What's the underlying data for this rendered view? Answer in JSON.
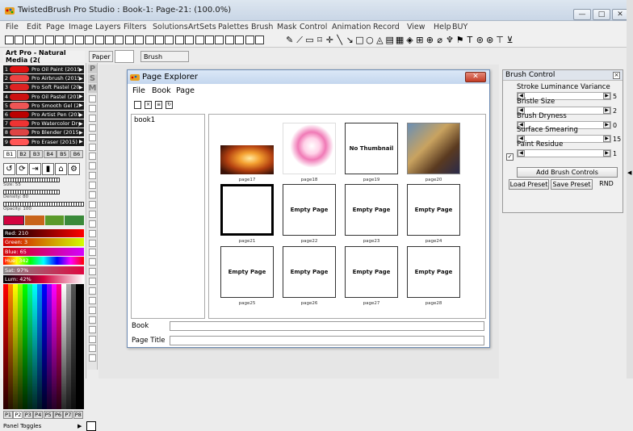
{
  "window": {
    "title": "TwistedBrush Pro Studio : Book-1: Page-21: (100.0%)"
  },
  "menu": [
    "File",
    "Edit",
    "Page",
    "Image",
    "Layers",
    "Filters",
    "Solutions",
    "ArtSets",
    "Palettes",
    "Brush",
    "Mask",
    "Control",
    "Animation",
    "Record",
    "View",
    "Help",
    "BUY"
  ],
  "preset_bar": {
    "artset": "Art Pro - Natural Media (2(",
    "paper_label": "Paper",
    "brush_label": "Brush"
  },
  "brushes": [
    {
      "num": "1",
      "label": "Pro Oil Paint (2015)",
      "color": "#d11"
    },
    {
      "num": "2",
      "label": "Pro Airbrush (2015)",
      "color": "#e44"
    },
    {
      "num": "3",
      "label": "Pro Soft Pastel (201)",
      "color": "#d22"
    },
    {
      "num": "4",
      "label": "Pro Oil Pastel (2015)",
      "color": "#c11"
    },
    {
      "num": "5",
      "label": "Pro Smooth Gel (201",
      "color": "#e55"
    },
    {
      "num": "6",
      "label": "Pro Artist Pen (2015)",
      "color": "#b00"
    },
    {
      "num": "7",
      "label": "Pro Watercolor Dry 2",
      "color": "#e33"
    },
    {
      "num": "8",
      "label": "Pro Blender (2015)",
      "color": "#d44"
    },
    {
      "num": "9",
      "label": "Pro Eraser (2015)",
      "color": "#f55"
    }
  ],
  "side_letters": [
    "P",
    "S",
    "M"
  ],
  "brush_pages": [
    "B1",
    "B2",
    "B3",
    "B4",
    "B5",
    "B6"
  ],
  "brush_settings": {
    "size": "Size: 55",
    "density": "Density: 80",
    "opacity": "Opacity: 100"
  },
  "color_sliders": [
    {
      "label": "Red: 210",
      "bg": "linear-gradient(90deg,#000,#f00)"
    },
    {
      "label": "Green: 3",
      "bg": "linear-gradient(90deg,#d20000,#d2ff00)"
    },
    {
      "label": "Blue: 65",
      "bg": "linear-gradient(90deg,#d20300,#d203ff)"
    },
    {
      "label": "Hue: 342",
      "bg": "linear-gradient(90deg,#f00,#ff0,#0f0,#0ff,#00f,#f0f,#f00)"
    },
    {
      "label": "Sat: 97%",
      "bg": "linear-gradient(90deg,#888,#e0063f)"
    },
    {
      "label": "Lum: 42%",
      "bg": "linear-gradient(90deg,#000,#d2033f,#fff)"
    }
  ],
  "palette_pages": [
    "P1",
    "P2",
    "P3",
    "P4",
    "P5",
    "P6",
    "P7",
    "P8"
  ],
  "panel_toggles": "Panel Toggles",
  "page_explorer": {
    "title": "Page Explorer",
    "menu": [
      "File",
      "Book",
      "Page"
    ],
    "book": "book1",
    "pages": [
      {
        "label": "page17",
        "content": "",
        "thumb": "fire"
      },
      {
        "label": "page18",
        "content": "",
        "thumb": "flower"
      },
      {
        "label": "page19",
        "content": "No Thumbnail",
        "thumb": ""
      },
      {
        "label": "page20",
        "content": "",
        "thumb": "scene"
      },
      {
        "label": "page21",
        "content": "",
        "thumb": "selected"
      },
      {
        "label": "page22",
        "content": "Empty Page",
        "thumb": ""
      },
      {
        "label": "page23",
        "content": "Empty Page",
        "thumb": ""
      },
      {
        "label": "page24",
        "content": "Empty Page",
        "thumb": ""
      },
      {
        "label": "page25",
        "content": "Empty Page",
        "thumb": ""
      },
      {
        "label": "page26",
        "content": "Empty Page",
        "thumb": ""
      },
      {
        "label": "page27",
        "content": "Empty Page",
        "thumb": ""
      },
      {
        "label": "page28",
        "content": "Empty Page",
        "thumb": ""
      }
    ],
    "book_label": "Book",
    "page_title_label": "Page Title"
  },
  "brush_control": {
    "title": "Brush Control",
    "controls": [
      {
        "label": "Stroke Luminance Variance",
        "value": "5"
      },
      {
        "label": "Bristle Size",
        "value": "2"
      },
      {
        "label": "Brush Dryness",
        "value": "0"
      },
      {
        "label": "Surface Smearing",
        "value": "15"
      },
      {
        "label": "Paint Residue",
        "value": "1"
      }
    ],
    "add_button": "Add Brush Controls",
    "load_button": "Load Preset",
    "save_button": "Save Preset",
    "rnd_button": "RND"
  }
}
